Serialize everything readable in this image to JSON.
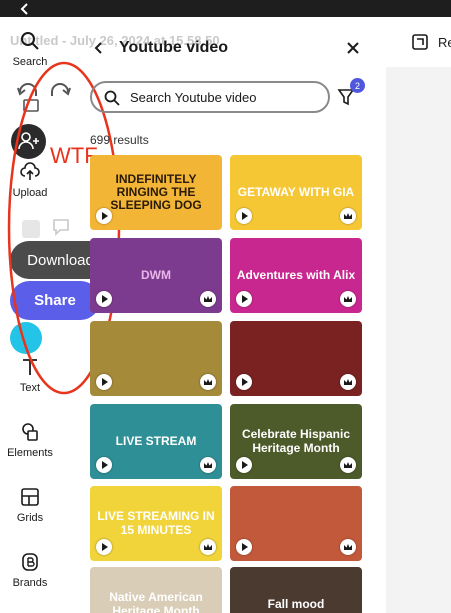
{
  "window": {
    "title": "Untitled - July 26, 2024 at 15.58.50"
  },
  "toolbar": {
    "resize_label": "Re"
  },
  "sidebar": {
    "items": [
      {
        "label": "Search",
        "icon": "search-icon"
      },
      {
        "label": "Upload",
        "icon": "upload-icon"
      },
      {
        "label": "Text",
        "icon": "text-icon"
      },
      {
        "label": "Elements",
        "icon": "elements-icon"
      },
      {
        "label": "Grids",
        "icon": "grids-icon"
      },
      {
        "label": "Brands",
        "icon": "brands-icon"
      }
    ]
  },
  "floating": {
    "download_label": "Download",
    "share_label": "Share",
    "annotation_text": "WTF",
    "annotation_color": "#e8341c"
  },
  "panel": {
    "title": "Youtube video",
    "search_placeholder": "Search Youtube video",
    "filter_count": "2",
    "results_text": "699 results"
  },
  "templates": [
    {
      "text": "INDEFINITELY RINGING THE SLEEPING DOG",
      "bg": "#f2b535",
      "fg": "#2a1a0a",
      "badge": "play"
    },
    {
      "text": "GETAWAY WITH GIA",
      "bg": "#f6c735",
      "fg": "#ffffff",
      "badge": "play-crown"
    },
    {
      "text": "DWM",
      "bg": "#7d3b8f",
      "fg": "#e8b6e8",
      "badge": "shapes-crown"
    },
    {
      "text": "Adventures with Alix",
      "bg": "#c8278f",
      "fg": "#ffffff",
      "badge": "shapes-crown"
    },
    {
      "text": "",
      "bg": "#a58a3a",
      "fg": "#ffffff",
      "badge": "play-crown"
    },
    {
      "text": "",
      "bg": "#7a2222",
      "fg": "#ffffff",
      "badge": "play-crown"
    },
    {
      "text": "LIVE STREAM",
      "bg": "#2f8f96",
      "fg": "#ffffff",
      "badge": "shapes-crown"
    },
    {
      "text": "Celebrate Hispanic Heritage Month",
      "bg": "#4d5a2a",
      "fg": "#ffffff",
      "badge": "shapes-crown"
    },
    {
      "text": "LIVE STREAMING IN 15 MINUTES",
      "bg": "#f1d33a",
      "fg": "#ffffff",
      "badge": "shapes-crown"
    },
    {
      "text": "",
      "bg": "#c2593a",
      "fg": "#ffffff",
      "badge": "play-crown"
    },
    {
      "text": "Native American Heritage Month",
      "bg": "#d9cdb8",
      "fg": "#ffffff",
      "badge": "none"
    },
    {
      "text": "Fall mood",
      "bg": "#4a3a30",
      "fg": "#ffffff",
      "badge": "none"
    }
  ]
}
